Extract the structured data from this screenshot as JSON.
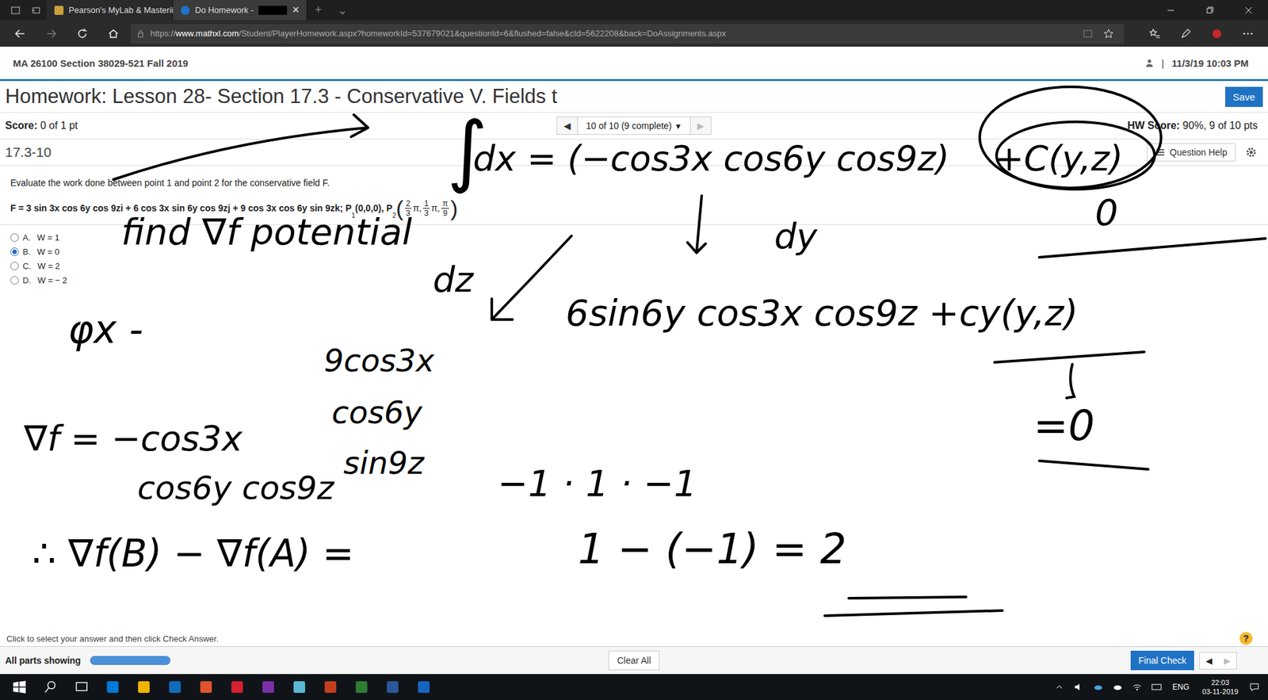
{
  "browser": {
    "tabs": [
      {
        "label": "Pearson's MyLab & Masterii",
        "selected": false,
        "redacted": false
      },
      {
        "label": "Do Homework -",
        "selected": true,
        "redacted": true
      }
    ],
    "close_tab": "×",
    "new_tab": "+",
    "tab_list": "⌄",
    "url_scheme": "https://",
    "url_host": "www.mathxl.com",
    "url_path": "/Student/PlayerHomework.aspx?homeworkId=537679021&questionId=6&flushed=false&cId=5622208&back=DoAssignments.aspx"
  },
  "page": {
    "course": "MA 26100 Section 38029-521 Fall 2019",
    "separator": "|",
    "datetime": "11/3/19 10:03 PM",
    "title": "Homework: Lesson 28- Section 17.3 - Conservative V. Fields t",
    "save": "Save",
    "score": {
      "label": "Score:",
      "value": "0 of 1 pt"
    },
    "nav": {
      "prev": "◀",
      "position": "10 of 10 (9 complete)",
      "dropdown": "▼",
      "next": "▶",
      "next_disabled": true
    },
    "hw_score": {
      "label": "HW Score:",
      "value": "90%, 9 of 10 pts"
    },
    "question_id": "17.3-10",
    "question_help": "Question Help",
    "instruction": "Evaluate the work done between point 1 and point 2 for the conservative field F.",
    "formula": {
      "lead": "F = 3 sin 3x cos 6y cos 9zi + 6 cos 3x sin 6y cos 9zj + 9 cos 3x cos 6y sin 9zk; P",
      "p1_sub": "1",
      "p1": "(0,0,0), P",
      "p2_sub": "2",
      "open": "(",
      "close": ")",
      "fractions": [
        {
          "num": "2",
          "den": "3",
          "tail": "π,"
        },
        {
          "num": "1",
          "den": "3",
          "tail": "π,"
        },
        {
          "num": "π",
          "den": "9",
          "tail": ""
        }
      ]
    },
    "options": [
      {
        "letter": "A.",
        "text": "W = 1",
        "selected": false
      },
      {
        "letter": "B.",
        "text": "W = 0",
        "selected": true
      },
      {
        "letter": "C.",
        "text": "W = 2",
        "selected": false
      },
      {
        "letter": "D.",
        "text": "W = − 2",
        "selected": false
      }
    ],
    "hint": "Click to select your answer and then click Check Answer.",
    "help": "?"
  },
  "footer": {
    "parts": "All parts showing",
    "level": 1,
    "clear": "Clear All",
    "final": "Final Check",
    "prev": "◀",
    "next": "▶",
    "next_disabled": true
  },
  "taskbar": {
    "lang": "ENG",
    "time": "22:03",
    "date": "03-11-2019"
  },
  "ink": [
    {
      "text": "∫"
    },
    {
      "text": "dx = (−cos3x cos6y cos9z)"
    },
    {
      "text": "+C(y,z)"
    },
    {
      "text": "find ∇f potential"
    },
    {
      "text": "dy"
    },
    {
      "text": "0"
    },
    {
      "text": "dz"
    },
    {
      "text": "6sin6y cos3x cos9z +cy(y,z)"
    },
    {
      "text": "φx -"
    },
    {
      "text": "9cos3x"
    },
    {
      "text": "cos6y"
    },
    {
      "text": "sin9z"
    },
    {
      "text": "∇f = −cos3x"
    },
    {
      "text": "cos6y cos9z"
    },
    {
      "text": "−1 · 1 · −1"
    },
    {
      "text": "=0"
    },
    {
      "text": "∴ ∇f(B) − ∇f(A) ="
    },
    {
      "text": "1 − (−1) = 2"
    }
  ]
}
